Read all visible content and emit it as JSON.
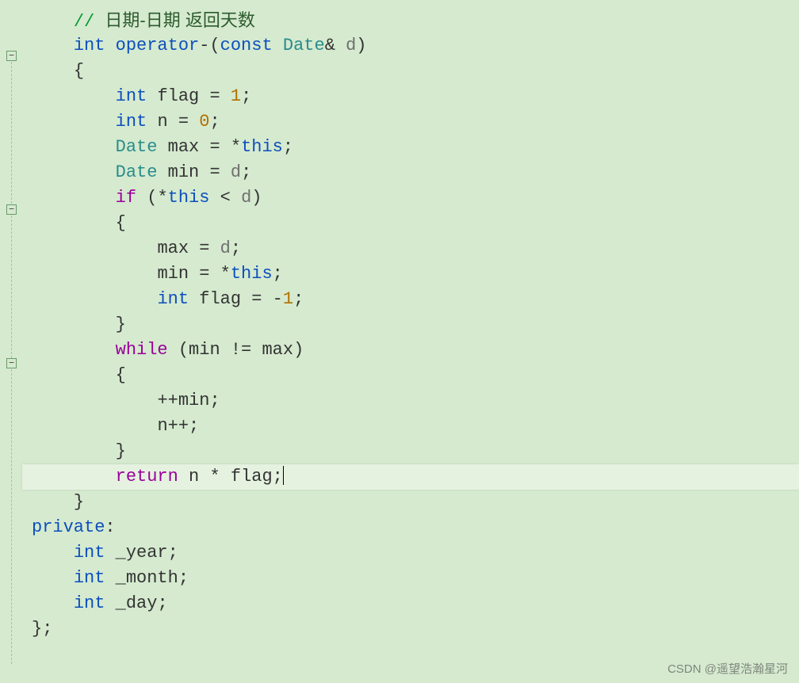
{
  "code": {
    "l00": {
      "comment_slash": "// ",
      "comment_cn": "日期-日期 返回天数"
    },
    "l01": {
      "kw_int": "int",
      "sp": " ",
      "op_kw": "operator",
      "minus": "-",
      "lparen": "(",
      "const": "const",
      "sp2": " ",
      "date": "Date",
      "amp": "& ",
      "d": "d",
      "rparen": ")"
    },
    "l02": {
      "brace": "{"
    },
    "l03": {
      "kw_int": "int",
      "sp": " ",
      "ident": "flag",
      "sp2": " ",
      "eq": "=",
      "sp3": " ",
      "num": "1",
      "semi": ";"
    },
    "l04": {
      "kw_int": "int",
      "sp": " ",
      "ident": "n",
      "sp2": " ",
      "eq": "=",
      "sp3": " ",
      "num": "0",
      "semi": ";"
    },
    "l05": {
      "date": "Date",
      "sp": " ",
      "ident": "max",
      "sp2": " ",
      "eq": "=",
      "sp3": " ",
      "star": "*",
      "this": "this",
      "semi": ";"
    },
    "l06": {
      "date": "Date",
      "sp": " ",
      "ident": "min",
      "sp2": " ",
      "eq": "=",
      "sp3": " ",
      "d": "d",
      "semi": ";"
    },
    "l07": {
      "if": "if",
      "sp": " ",
      "lparen": "(",
      "star": "*",
      "this": "this",
      "sp2": " ",
      "lt": "<",
      "sp3": " ",
      "d": "d",
      "rparen": ")"
    },
    "l08": {
      "brace": "{"
    },
    "l09": {
      "ident": "max",
      "sp": " ",
      "eq": "=",
      "sp2": " ",
      "d": "d",
      "semi": ";"
    },
    "l10": {
      "ident": "min",
      "sp": " ",
      "eq": "=",
      "sp2": " ",
      "star": "*",
      "this": "this",
      "semi": ";"
    },
    "l11": {
      "kw_int": "int",
      "sp": " ",
      "ident": "flag",
      "sp2": " ",
      "eq": "=",
      "sp3": " ",
      "minus": "-",
      "num": "1",
      "semi": ";"
    },
    "l12": {
      "brace": "}"
    },
    "l13": {
      "while": "while",
      "sp": " ",
      "lparen": "(",
      "min": "min",
      "sp2": " ",
      "neq": "!=",
      "sp3": " ",
      "max": "max",
      "rparen": ")"
    },
    "l14": {
      "brace": "{"
    },
    "l15": {
      "inc": "++",
      "ident": "min",
      "semi": ";"
    },
    "l16": {
      "ident": "n",
      "inc": "++",
      "semi": ";"
    },
    "l17": {
      "brace": "}"
    },
    "l18": {
      "return": "return",
      "sp": " ",
      "n": "n",
      "sp2": " ",
      "star": "*",
      "sp3": " ",
      "flag": "flag",
      "semi": ";"
    },
    "l19": {
      "brace": "}"
    },
    "l20": {
      "private": "private",
      "colon": ":"
    },
    "l21": {
      "kw_int": "int",
      "sp": " ",
      "ident": "_year",
      "semi": ";"
    },
    "l22": {
      "kw_int": "int",
      "sp": " ",
      "ident": "_month",
      "semi": ";"
    },
    "l23": {
      "kw_int": "int",
      "sp": " ",
      "ident": "_day",
      "semi": ";"
    },
    "l24": {
      "brace": "}",
      "semi": ";"
    }
  },
  "watermark": "CSDN @遥望浩瀚星河"
}
